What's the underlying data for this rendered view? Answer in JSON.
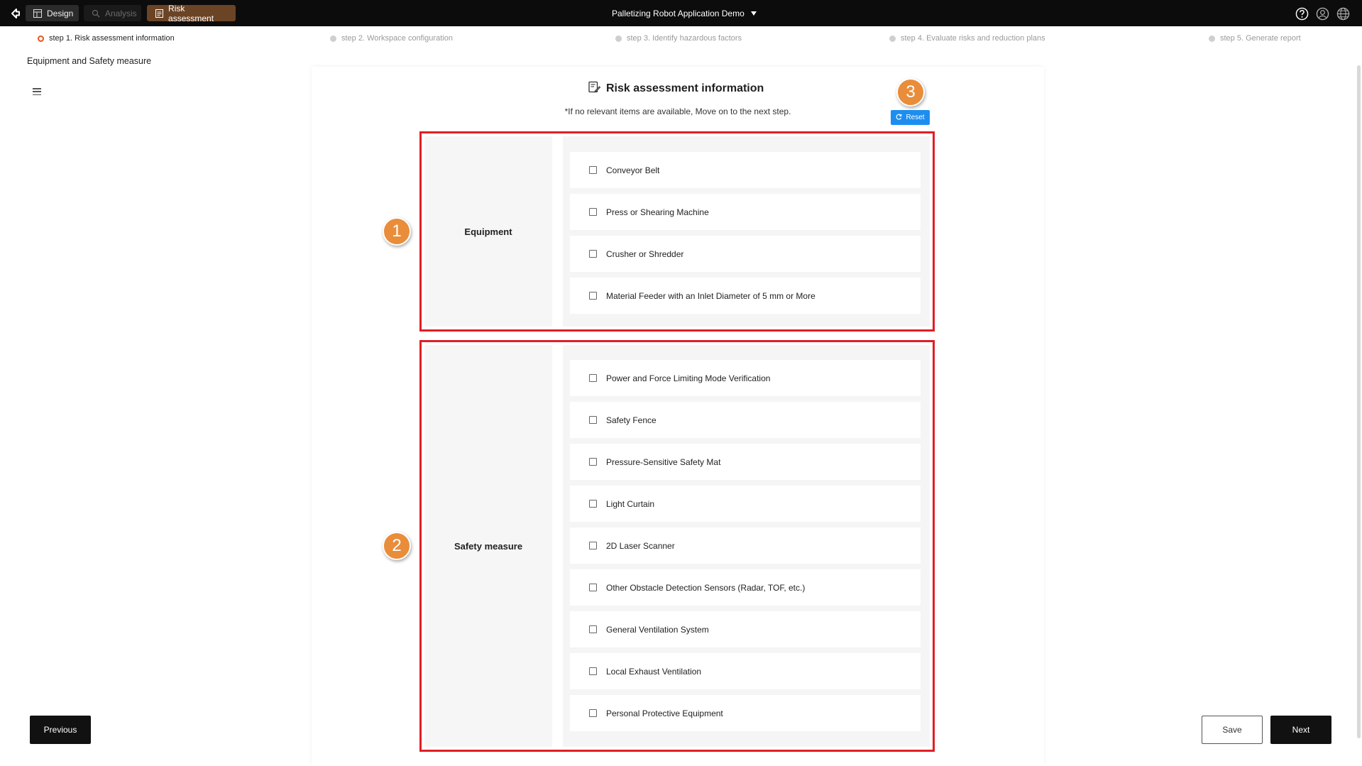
{
  "header": {
    "tabs": [
      {
        "label": "Design",
        "icon": "layout-icon"
      },
      {
        "label": "Analysis",
        "icon": "analysis-icon"
      },
      {
        "label": "Risk assessment",
        "icon": "document-icon"
      }
    ],
    "project_name": "Palletizing Robot Application Demo",
    "icons": [
      "help-icon",
      "user-icon",
      "globe-icon"
    ]
  },
  "steps": [
    {
      "label": "step 1. Risk assessment information",
      "active": true
    },
    {
      "label": "step 2. Workspace configuration",
      "active": false
    },
    {
      "label": "step 3. Identify hazardous factors",
      "active": false
    },
    {
      "label": "step 4. Evaluate risks and reduction plans",
      "active": false
    },
    {
      "label": "step 5. Generate report",
      "active": false
    }
  ],
  "sidebar": {
    "section_label": "Equipment and Safety measure"
  },
  "form": {
    "title": "Risk assessment information",
    "note": "*If no relevant items are available, Move on to the next step.",
    "reset_label": "Reset",
    "equipment": {
      "label": "Equipment",
      "items": [
        {
          "label": "Conveyor Belt",
          "checked": false
        },
        {
          "label": "Press or Shearing Machine",
          "checked": false
        },
        {
          "label": "Crusher or Shredder",
          "checked": false
        },
        {
          "label": "Material Feeder with an Inlet Diameter of 5 mm or More",
          "checked": false
        }
      ]
    },
    "safety": {
      "label": "Safety measure",
      "items": [
        {
          "label": "Power and Force Limiting Mode Verification",
          "checked": false
        },
        {
          "label": "Safety Fence",
          "checked": false
        },
        {
          "label": "Pressure-Sensitive Safety Mat",
          "checked": false
        },
        {
          "label": "Light Curtain",
          "checked": false
        },
        {
          "label": "2D Laser Scanner",
          "checked": false
        },
        {
          "label": "Other Obstacle Detection Sensors (Radar, TOF, etc.)",
          "checked": false
        },
        {
          "label": "General Ventilation System",
          "checked": false
        },
        {
          "label": "Local Exhaust Ventilation",
          "checked": false
        },
        {
          "label": "Personal Protective Equipment",
          "checked": false
        }
      ]
    }
  },
  "annotations": [
    "1",
    "2",
    "3"
  ],
  "footer": {
    "previous_label": "Previous",
    "save_label": "Save",
    "next_label": "Next"
  },
  "colors": {
    "active_tab": "#6b4426",
    "active_step": "#e8541f",
    "reset_button": "#1d8ef0",
    "highlight_border": "#e01e26",
    "badge": "#e98d3a"
  }
}
